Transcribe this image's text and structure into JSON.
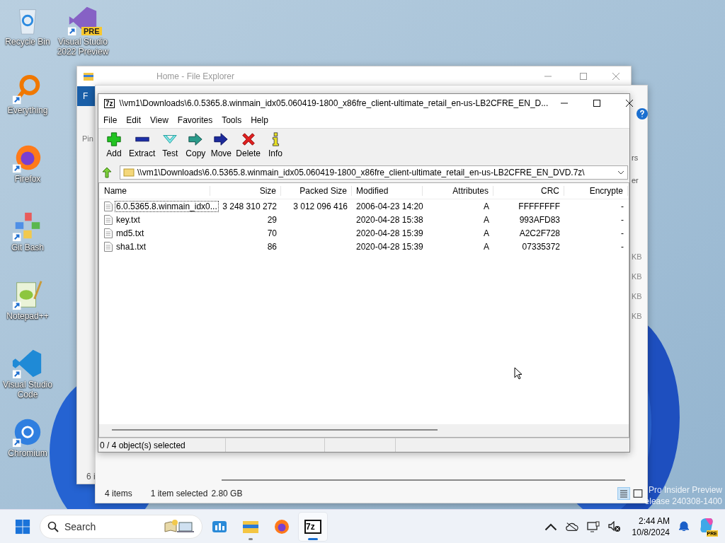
{
  "desktop_icons": [
    {
      "label": "Recycle Bin",
      "kind": "recycle",
      "shortcut": false
    },
    {
      "label": "Everything",
      "kind": "everything",
      "shortcut": true
    },
    {
      "label": "Firefox",
      "kind": "firefox",
      "shortcut": true
    },
    {
      "label": "Git Bash",
      "kind": "git",
      "shortcut": true
    },
    {
      "label": "Notepad++",
      "kind": "notepad",
      "shortcut": true
    },
    {
      "label": "Visual Studio Code",
      "kind": "vscode",
      "shortcut": true
    },
    {
      "label": "Chromium",
      "kind": "chromium",
      "shortcut": true
    },
    {
      "label": "Visual Studio 2022 Preview",
      "kind": "vs",
      "shortcut": true,
      "badge": "PRE"
    }
  ],
  "explorer_back": {
    "title": "Home - File Explorer",
    "ribbon_tab": "F",
    "pin_label": "Pin",
    "count_fragment": "6 i"
  },
  "explorer_front": {
    "ribbon_fragments": [
      "rs",
      "er"
    ],
    "size_fragments": [
      "KB",
      "KB",
      "KB",
      "KB"
    ],
    "status": {
      "items": "4 items",
      "selection": "1 item selected",
      "size": "2.80 GB"
    }
  },
  "sevenzip": {
    "app_icon": "7z",
    "title": "\\\\vm1\\Downloads\\6.0.5365.8.winmain_idx05.060419-1800_x86fre_client-ultimate_retail_en-us-LB2CFRE_EN_D...",
    "menu": [
      "File",
      "Edit",
      "View",
      "Favorites",
      "Tools",
      "Help"
    ],
    "toolbar": [
      {
        "label": "Add",
        "kind": "add"
      },
      {
        "label": "Extract",
        "kind": "extract"
      },
      {
        "label": "Test",
        "kind": "test"
      },
      {
        "label": "Copy",
        "kind": "copy"
      },
      {
        "label": "Move",
        "kind": "move"
      },
      {
        "label": "Delete",
        "kind": "delete"
      },
      {
        "label": "Info",
        "kind": "info"
      }
    ],
    "address": "\\\\vm1\\Downloads\\6.0.5365.8.winmain_idx05.060419-1800_x86fre_client-ultimate_retail_en-us-LB2CFRE_EN_DVD.7z\\",
    "columns": [
      "Name",
      "Size",
      "Packed Size",
      "Modified",
      "Attributes",
      "CRC",
      "Encrypte"
    ],
    "rows": [
      {
        "cells": [
          "6.0.5365.8.winmain_idx0...",
          "3 248 310 272",
          "3 012 096 416",
          "2006-04-23 14:20",
          "A",
          "FFFFFFFF",
          "-"
        ],
        "focused": true
      },
      {
        "cells": [
          "key.txt",
          "29",
          "",
          "2020-04-28 15:38",
          "A",
          "993AFD83",
          "-"
        ],
        "focused": false
      },
      {
        "cells": [
          "md5.txt",
          "70",
          "",
          "2020-04-28 15:39",
          "A",
          "A2C2F728",
          "-"
        ],
        "focused": false
      },
      {
        "cells": [
          "sha1.txt",
          "86",
          "",
          "2020-04-28 15:39",
          "A",
          "07335372",
          "-"
        ],
        "focused": false
      }
    ],
    "status": "0 / 4 object(s) selected"
  },
  "watermark": [
    "Pro Insider Preview",
    "elease 240308-1400"
  ],
  "taskbar": {
    "search_placeholder": "Search",
    "apps": [
      {
        "kind": "widgets",
        "running": false,
        "active": false
      },
      {
        "kind": "explorer",
        "running": true,
        "active": false
      },
      {
        "kind": "firefox",
        "running": false,
        "active": false
      },
      {
        "kind": "sevenzip",
        "running": true,
        "active": true,
        "badge": "7z"
      }
    ],
    "time": "2:44 AM",
    "date": "10/8/2024",
    "copilot_badge": "PRE"
  }
}
